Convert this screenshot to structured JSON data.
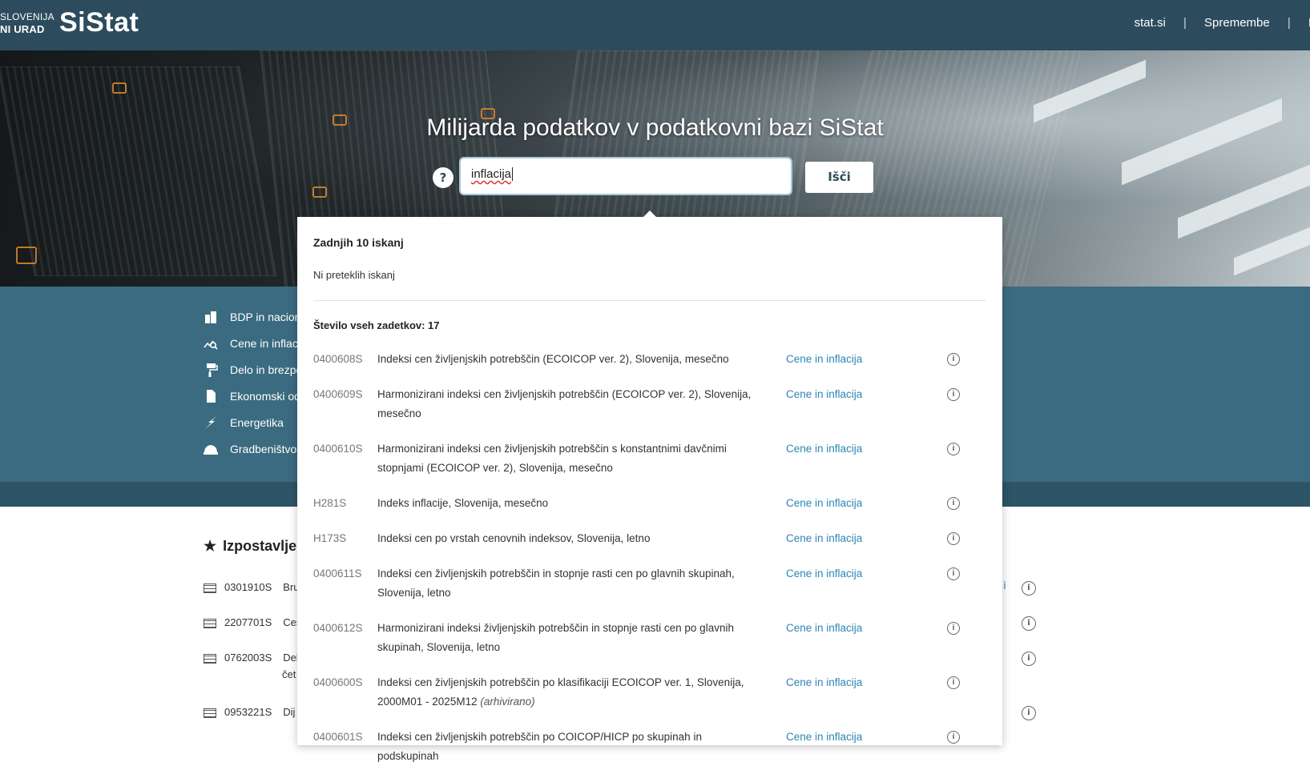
{
  "header": {
    "org_line1": "SLOVENIJA",
    "org_line2": "NI URAD",
    "logo": "SiStat",
    "nav": [
      "stat.si",
      "Spremembe",
      "P"
    ]
  },
  "hero": {
    "title": "Milijarda podatkov v podatkovni bazi SiStat",
    "help": "?",
    "search_value": "inflacija",
    "search_button": "Išči"
  },
  "categories": [
    {
      "label": "BDP in nacion",
      "icon": "building-icon"
    },
    {
      "label": "Cene in inflaci",
      "icon": "chart-search-icon"
    },
    {
      "label": "Delo in brezpo",
      "icon": "paint-roller-icon"
    },
    {
      "label": "Ekonomski od",
      "icon": "document-icon"
    },
    {
      "label": "Energetika",
      "icon": "lightning-icon"
    },
    {
      "label": "Gradbeništvo",
      "icon": "helmet-icon"
    }
  ],
  "featured": {
    "title": "Izpostavlje",
    "rows": [
      {
        "code": "0301910S",
        "text": "Bru"
      },
      {
        "code": "2207701S",
        "text": "Ces"
      },
      {
        "code": "0762003S",
        "text": "Del",
        "text2": "čet"
      },
      {
        "code": "0953221S",
        "text": "Dij"
      }
    ],
    "link_fragment": "ni"
  },
  "dropdown": {
    "recent_title": "Zadnjih 10 iskanj",
    "recent_empty": "Ni preteklih iskanj",
    "total_label": "Število vseh zadetkov: 17",
    "results": [
      {
        "code": "0400608S",
        "title": "Indeksi cen življenjskih potrebščin (ECOICOP ver. 2), Slovenija, mesečno",
        "category": "Cene in inflacija"
      },
      {
        "code": "0400609S",
        "title": "Harmonizirani indeksi cen življenjskih potrebščin (ECOICOP ver. 2), Slovenija, mesečno",
        "category": "Cene in inflacija"
      },
      {
        "code": "0400610S",
        "title": "Harmonizirani indeksi cen življenjskih potrebščin s konstantnimi davčnimi stopnjami (ECOICOP ver. 2), Slovenija, mesečno",
        "category": "Cene in inflacija"
      },
      {
        "code": "H281S",
        "title": "Indeks inflacije, Slovenija, mesečno",
        "category": "Cene in inflacija"
      },
      {
        "code": "H173S",
        "title": "Indeksi cen po vrstah cenovnih indeksov, Slovenija, letno",
        "category": "Cene in inflacija"
      },
      {
        "code": "0400611S",
        "title": "Indeksi cen življenjskih potrebščin in stopnje rasti cen po glavnih skupinah, Slovenija, letno",
        "category": "Cene in inflacija"
      },
      {
        "code": "0400612S",
        "title": "Harmonizirani indeksi življenjskih potrebščin in stopnje rasti cen po glavnih skupinah, Slovenija, letno",
        "category": "Cene in inflacija"
      },
      {
        "code": "0400600S",
        "title": "Indeksi cen življenjskih potrebščin po klasifikaciji ECOICOP ver. 1, Slovenija, 2000M01 - 2025M12",
        "archived": "(arhivirano)",
        "category": "Cene in inflacija"
      },
      {
        "code": "0400601S",
        "title": "Indeksi cen življenjskih potrebščin po COICOP/HICP po skupinah in podskupinah",
        "category": "Cene in inflacija"
      }
    ]
  }
}
